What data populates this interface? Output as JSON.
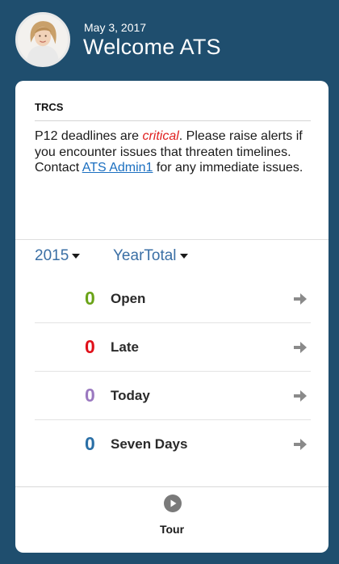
{
  "header": {
    "date": "May 3, 2017",
    "welcome": "Welcome ATS",
    "avatar_icon": "user-avatar-icon"
  },
  "card": {
    "title": "TRCS",
    "message": {
      "prefix": "P12 deadlines are ",
      "emphasis": "critical",
      "middle": ". Please raise alerts if you encounter issues that threaten timelines. Contact ",
      "link": "ATS Admin1",
      "suffix": " for any immediate issues."
    },
    "year_select": "2015",
    "period_select": "YearTotal",
    "statuses": [
      {
        "count": "0",
        "label": "Open",
        "color": "#6aa318"
      },
      {
        "count": "0",
        "label": "Late",
        "color": "#e0101a"
      },
      {
        "count": "0",
        "label": "Today",
        "color": "#9b79c0"
      },
      {
        "count": "0",
        "label": "Seven Days",
        "color": "#2a6fa6"
      }
    ],
    "tour_label": "Tour"
  },
  "colors": {
    "background": "#1f4e6e",
    "accent_link": "#1b6fc0",
    "select_text": "#3a6fa5",
    "arrow": "#8a8a8a"
  }
}
